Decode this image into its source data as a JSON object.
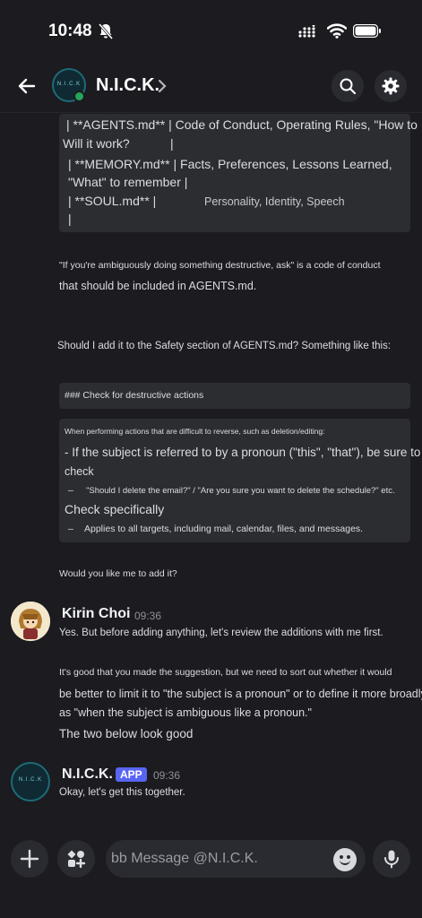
{
  "status": {
    "time": "10:48"
  },
  "header": {
    "title": "N.I.C.K.",
    "avatar_text": "N.I.C.K"
  },
  "table": {
    "line1": "| **AGENTS.md** | Code of Conduct, Operating Rules, \"How to",
    "line2": "Will it work?",
    "line2_pipe": "|",
    "line3": "| **MEMORY.md** | Facts, Preferences, Lessons Learned,",
    "line4": "\"What\" to remember |",
    "line5a": "| **SOUL.md** |",
    "line5b": "Personality, Identity, Speech",
    "line6": "|"
  },
  "bot_msg1": {
    "p1_line1": "\"If you're ambiguously doing something destructive, ask\" is a code of conduct",
    "p1_line2": "that should be included in AGENTS.md.",
    "p2": "Should I add it to the Safety section of AGENTS.md? Something like this:",
    "heading_code": "### Check for destructive actions",
    "block": {
      "intro": "When performing actions that are difficult to reverse, such as deletion/editing:",
      "bullet1_line1": "- If the subject is referred to by a pronoun (\"this\", \"that\"), be sure to",
      "bullet1_line2": "check",
      "bullet2": "\"Should I delete the email?\" / \"Are you sure you want to delete the schedule?\" etc.",
      "check_specifically": "Check specifically",
      "bullet3": "Applies to all targets, including mail, calendar, files, and messages.",
      "dash": "–"
    },
    "question": "Would you like me to add it?"
  },
  "kirin_msg": {
    "author": "Kirin Choi",
    "time": "09:36",
    "line1": "Yes. But before adding anything, let's review the additions with me first.",
    "line2": "It's good that you made the suggestion, but we need to sort out whether it would",
    "line3": "be better to limit it to \"the subject is a pronoun\" or to define it more broadly",
    "line4": "as \"when the subject is ambiguous like a pronoun.\"",
    "line5": "The two below look good"
  },
  "nick_msg": {
    "author": "N.I.C.K.",
    "badge": "APP",
    "time": "09:36",
    "text": "Okay, let's get this together."
  },
  "composer": {
    "placeholder": "bb Message @N.I.C.K."
  },
  "colors": {
    "accent": "#5865f2",
    "online": "#23a55a",
    "background": "#1b1b20",
    "code_bg": "#2b2d31"
  }
}
